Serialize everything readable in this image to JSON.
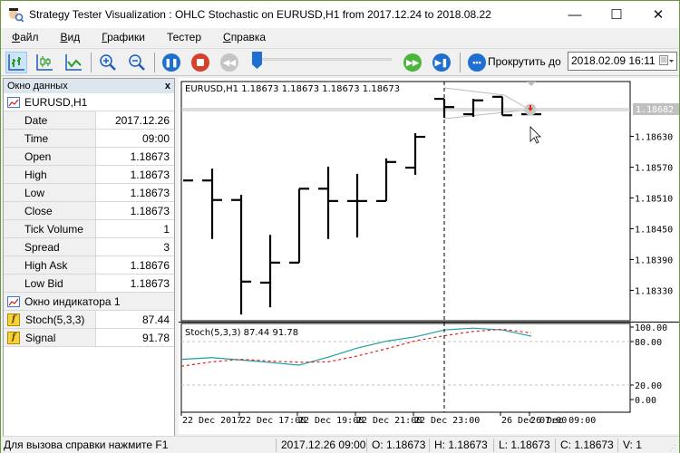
{
  "window": {
    "title": "Strategy Tester Visualization : OHLC Stochastic on EURUSD,H1 from 2017.12.24 to 2018.08.22",
    "minimize": "—",
    "maximize": "☐",
    "close": "✕"
  },
  "menu": [
    {
      "label": "Файл",
      "accel": "Ф",
      "rest": "айл"
    },
    {
      "label": "Вид",
      "accel": "В",
      "rest": "ид"
    },
    {
      "label": "Графики",
      "accel": "Г",
      "rest": "рафики"
    },
    {
      "label": "Тестер",
      "accel": "",
      "rest": "Тестер"
    },
    {
      "label": "Справка",
      "accel": "С",
      "rest": "правка"
    }
  ],
  "toolbar": {
    "buttons": [
      {
        "name": "bar-chart-icon",
        "active": true
      },
      {
        "name": "candlestick-chart-icon",
        "active": false
      },
      {
        "name": "line-chart-icon",
        "active": false
      },
      {
        "name": "zoom-in-icon",
        "active": false
      },
      {
        "name": "zoom-out-icon",
        "active": false
      },
      {
        "name": "pause-icon",
        "active": false
      },
      {
        "name": "stop-icon",
        "active": false
      },
      {
        "name": "rewind-icon",
        "active": false
      },
      {
        "name": "fast-forward-icon",
        "active": false
      },
      {
        "name": "step-forward-icon",
        "active": false
      },
      {
        "name": "scroll-to-icon",
        "active": false
      }
    ],
    "speed_slider": 0.0,
    "scroll_label": "Прокрутить до",
    "scroll_date": "2018.02.09 16:11"
  },
  "data_window": {
    "title": "Окно данных",
    "close": "x",
    "symbol": "EURUSD,H1",
    "rows": [
      {
        "key": "Date",
        "value": "2017.12.26"
      },
      {
        "key": "Time",
        "value": "09:00"
      },
      {
        "key": "Open",
        "value": "1.18673"
      },
      {
        "key": "High",
        "value": "1.18673"
      },
      {
        "key": "Low",
        "value": "1.18673"
      },
      {
        "key": "Close",
        "value": "1.18673"
      },
      {
        "key": "Tick Volume",
        "value": "1"
      },
      {
        "key": "Spread",
        "value": "3"
      },
      {
        "key": "High Ask",
        "value": "1.18676"
      },
      {
        "key": "Low Bid",
        "value": "1.18673"
      }
    ],
    "indicator_window": "Окно индикатора 1",
    "indicator_rows": [
      {
        "key": "Stoch(5,3,3)",
        "value": "87.44"
      },
      {
        "key": "Signal",
        "value": "91.78"
      }
    ]
  },
  "chart_data": [
    {
      "type": "ohlc",
      "title": "EURUSD,H1  1.18673 1.18673 1.18673 1.18673",
      "current_price_label": "1.18682",
      "ylim": [
        1.18275,
        1.18737
      ],
      "yticks": [
        "1.18630",
        "1.18570",
        "1.18510",
        "1.18450",
        "1.18390",
        "1.18330"
      ],
      "ytick_values": [
        1.1863,
        1.1857,
        1.1851,
        1.1845,
        1.1839,
        1.1833
      ],
      "current_price": 1.18682,
      "bars": [
        {
          "o": null,
          "h": null,
          "l": null,
          "c": 1.18544
        },
        {
          "o": 1.18544,
          "h": 1.18567,
          "l": 1.1843,
          "c": 1.18506
        },
        {
          "o": 1.18506,
          "h": 1.18516,
          "l": 1.18283,
          "c": 1.18347
        },
        {
          "o": 1.18345,
          "h": 1.18438,
          "l": 1.18297,
          "c": 1.18384
        },
        {
          "o": 1.18384,
          "h": 1.18528,
          "l": 1.18384,
          "c": 1.18528
        },
        {
          "o": 1.18528,
          "h": 1.18571,
          "l": 1.1843,
          "c": 1.18504
        },
        {
          "o": 1.18504,
          "h": 1.18557,
          "l": 1.18433,
          "c": 1.18504
        },
        {
          "o": 1.18504,
          "h": 1.18587,
          "l": 1.18504,
          "c": 1.1858
        },
        {
          "o": 1.18569,
          "h": 1.18636,
          "l": 1.18555,
          "c": 1.18629
        },
        {
          "o": 1.18703,
          "h": 1.18703,
          "l": 1.18666,
          "c": 1.18687
        },
        {
          "o": 1.18673,
          "h": 1.18703,
          "l": 1.18668,
          "c": 1.187
        },
        {
          "o": 1.18707,
          "h": 1.18707,
          "l": 1.18671,
          "c": 1.18671
        },
        {
          "o": 1.18673,
          "h": 1.18673,
          "l": 1.18673,
          "c": 1.18673
        }
      ],
      "cursor_bar_index": 9
    },
    {
      "type": "line",
      "title": "Stoch(5,3,3) 87.44 91.78",
      "ylim": [
        0,
        100
      ],
      "yticks": [
        "100.00",
        "80.00",
        "20.00",
        "0.00"
      ],
      "ytick_values": [
        100,
        80,
        20,
        0
      ],
      "levels": [
        80,
        20
      ],
      "series": [
        {
          "name": "Stoch(5,3,3)",
          "color": "#20a0a0",
          "style": "solid",
          "values": [
            55.5,
            57.8,
            54.5,
            51.2,
            47.5,
            58.5,
            71.0,
            80.5,
            86.5,
            96.0,
            98.5,
            96.0,
            87.4
          ]
        },
        {
          "name": "Signal",
          "color": "#e02020",
          "style": "dashed",
          "values": [
            46.0,
            52.0,
            55.5,
            53.0,
            51.5,
            52.0,
            60.0,
            70.0,
            81.0,
            88.0,
            94.0,
            97.0,
            91.8
          ]
        }
      ],
      "x_labels": [
        "22 Dec 2017",
        "22 Dec 17:00",
        "22 Dec 19:00",
        "22 Dec 21:00",
        "22 Dec 23:00",
        "26 Dec 07:00",
        "26 Dec 09:00"
      ],
      "x_label_bar_index": [
        0,
        2,
        4,
        6,
        8,
        11,
        12
      ]
    }
  ],
  "statusbar": {
    "help": "Для вызова справки нажмите F1",
    "datetime": "2017.12.26 09:00",
    "open": "O: 1.18673",
    "high": "H: 1.18673",
    "low": "L: 1.18673",
    "close": "C: 1.18673",
    "volume": "V: 1"
  }
}
